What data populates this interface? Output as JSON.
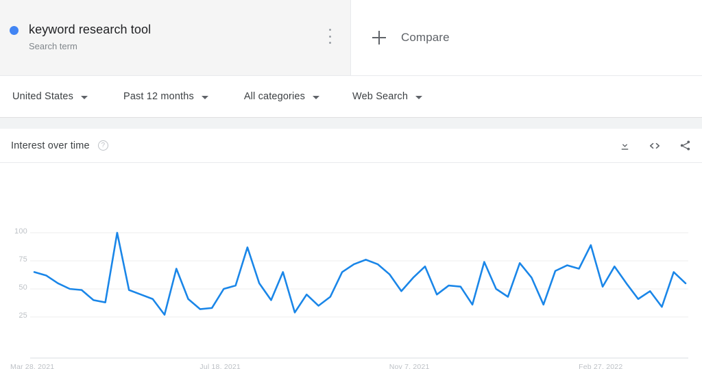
{
  "header": {
    "term": {
      "title": "keyword research tool",
      "subtitle": "Search term",
      "dot_color": "#4285f4",
      "menu_icon": "kebab-menu-icon"
    },
    "compare": {
      "label": "Compare",
      "icon": "plus-icon"
    }
  },
  "filters": [
    {
      "label": "United States",
      "icon": "chevron-down-icon"
    },
    {
      "label": "Past 12 months",
      "icon": "chevron-down-icon"
    },
    {
      "label": "All categories",
      "icon": "chevron-down-icon"
    },
    {
      "label": "Web Search",
      "icon": "chevron-down-icon"
    }
  ],
  "chart_panel": {
    "title": "Interest over time",
    "help_icon": "help-circle-icon",
    "help_glyph": "?",
    "actions": [
      {
        "name": "download-icon",
        "label": "Download"
      },
      {
        "name": "embed-code-icon",
        "label": "Embed"
      },
      {
        "name": "share-icon",
        "label": "Share"
      }
    ]
  },
  "chart_data": {
    "type": "line",
    "title": "Interest over time",
    "xlabel": "",
    "ylabel": "",
    "ylim": [
      0,
      100
    ],
    "yticks": [
      25,
      50,
      75,
      100
    ],
    "ytick_labels": [
      "25",
      "50",
      "75",
      "100"
    ],
    "grid": true,
    "legend": false,
    "line_color": "#1a86e8",
    "line_width": 2.6,
    "x_tick_labels": [
      "Mar 28, 2021",
      "Jul 18, 2021",
      "Nov 7, 2021",
      "Feb 27, 2022"
    ],
    "x_tick_indices": [
      0,
      16,
      32,
      48
    ],
    "x": [
      "Mar 28, 2021",
      "Apr 4, 2021",
      "Apr 11, 2021",
      "Apr 18, 2021",
      "Apr 25, 2021",
      "May 2, 2021",
      "May 9, 2021",
      "May 16, 2021",
      "May 23, 2021",
      "May 30, 2021",
      "Jun 6, 2021",
      "Jun 13, 2021",
      "Jun 20, 2021",
      "Jun 27, 2021",
      "Jul 4, 2021",
      "Jul 11, 2021",
      "Jul 18, 2021",
      "Jul 25, 2021",
      "Aug 1, 2021",
      "Aug 8, 2021",
      "Aug 15, 2021",
      "Aug 22, 2021",
      "Aug 29, 2021",
      "Sep 5, 2021",
      "Sep 12, 2021",
      "Sep 19, 2021",
      "Sep 26, 2021",
      "Oct 3, 2021",
      "Oct 10, 2021",
      "Oct 17, 2021",
      "Oct 24, 2021",
      "Oct 31, 2021",
      "Nov 7, 2021",
      "Nov 14, 2021",
      "Nov 21, 2021",
      "Nov 28, 2021",
      "Dec 5, 2021",
      "Dec 12, 2021",
      "Dec 19, 2021",
      "Dec 26, 2021",
      "Jan 2, 2022",
      "Jan 9, 2022",
      "Jan 16, 2022",
      "Jan 23, 2022",
      "Jan 30, 2022",
      "Feb 6, 2022",
      "Feb 13, 2022",
      "Feb 20, 2022",
      "Feb 27, 2022",
      "Mar 6, 2022",
      "Mar 13, 2022",
      "Mar 20, 2022"
    ],
    "values": [
      65,
      62,
      55,
      50,
      49,
      40,
      38,
      100,
      49,
      45,
      41,
      27,
      68,
      41,
      32,
      33,
      50,
      53,
      87,
      55,
      40,
      65,
      29,
      45,
      35,
      43,
      65,
      72,
      76,
      72,
      63,
      48,
      60,
      70,
      45,
      53,
      52,
      36,
      74,
      50,
      43,
      73,
      60,
      36,
      66,
      71,
      68,
      89,
      52,
      70,
      55,
      41,
      48,
      34,
      65,
      55
    ],
    "series": [
      {
        "name": "keyword research tool",
        "color": "#1a86e8",
        "values": [
          65,
          62,
          55,
          50,
          49,
          40,
          38,
          100,
          49,
          45,
          41,
          27,
          68,
          41,
          32,
          33,
          50,
          53,
          87,
          55,
          40,
          65,
          29,
          45,
          35,
          43,
          65,
          72,
          76,
          72,
          63,
          48,
          60,
          70,
          45,
          53,
          52,
          36,
          74,
          50,
          43,
          73,
          60,
          36,
          66,
          71,
          68,
          89,
          52,
          70,
          55,
          41,
          48,
          34,
          65,
          55
        ]
      }
    ]
  }
}
